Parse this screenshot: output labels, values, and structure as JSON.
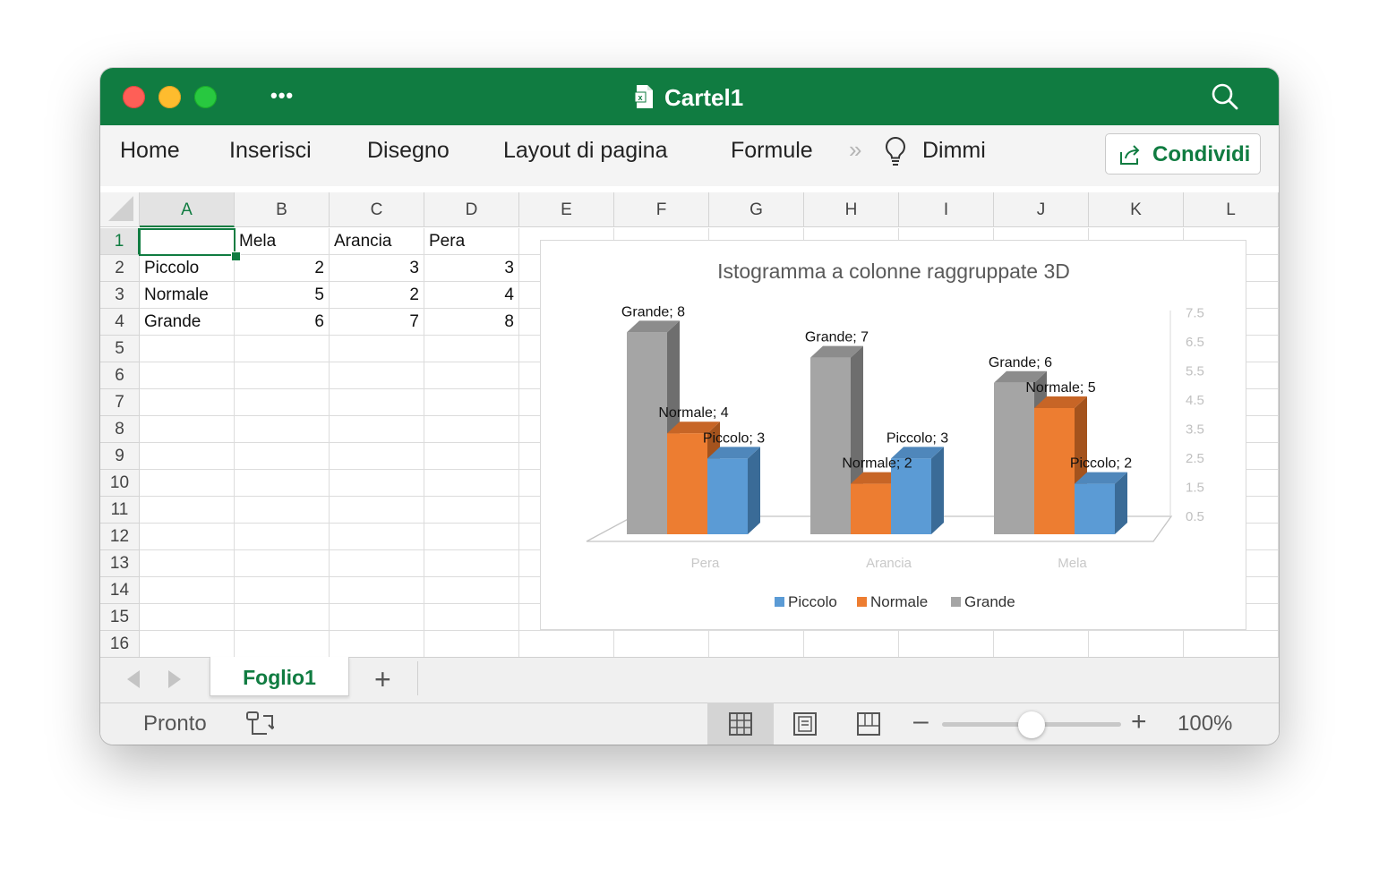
{
  "window": {
    "title": "Cartel1",
    "more": "•••"
  },
  "ribbon": {
    "tabs": [
      "Home",
      "Inserisci",
      "Disegno",
      "Layout di pagina",
      "Formule"
    ],
    "overflow": "»",
    "tell_me": "Dimmi",
    "share_label": "Condividi"
  },
  "sheet": {
    "columns": [
      "A",
      "B",
      "C",
      "D",
      "E",
      "F",
      "G",
      "H",
      "I",
      "J",
      "K",
      "L"
    ],
    "rows": [
      "1",
      "2",
      "3",
      "4",
      "5",
      "6",
      "7",
      "8",
      "9",
      "10",
      "11",
      "12",
      "13",
      "14",
      "15",
      "16"
    ],
    "cells": {
      "B1": "Mela",
      "C1": "Arancia",
      "D1": "Pera",
      "A2": "Piccolo",
      "B2": "2",
      "C2": "3",
      "D2": "3",
      "A3": "Normale",
      "B3": "5",
      "C3": "2",
      "D3": "4",
      "A4": "Grande",
      "B4": "6",
      "C4": "7",
      "D4": "8"
    }
  },
  "chart_data": {
    "type": "bar",
    "title": "Istogramma a colonne raggruppate 3D",
    "categories": [
      "Pera",
      "Arancia",
      "Mela"
    ],
    "series": [
      {
        "name": "Piccolo",
        "values": [
          3,
          3,
          2
        ],
        "color": "#5b9bd5",
        "side_color": "#3a6b97",
        "top_color": "#4f87bb"
      },
      {
        "name": "Normale",
        "values": [
          4,
          2,
          5
        ],
        "color": "#ed7d31",
        "side_color": "#a4531d",
        "top_color": "#c76526"
      },
      {
        "name": "Grande",
        "values": [
          8,
          7,
          6
        ],
        "color": "#a5a5a5",
        "side_color": "#6e6e6e",
        "top_color": "#8c8c8c"
      }
    ],
    "y_ticks": [
      "0.5",
      "1.5",
      "2.5",
      "3.5",
      "4.5",
      "5.5",
      "6.5",
      "7.5"
    ],
    "ylim": [
      0,
      8
    ],
    "legend_position": "bottom"
  },
  "sheet_tabs": {
    "active": "Foglio1",
    "add": "+"
  },
  "status": {
    "text": "Pronto",
    "zoom_minus": "–",
    "zoom_plus": "+",
    "zoom": "100%",
    "zoom_level": 100
  }
}
